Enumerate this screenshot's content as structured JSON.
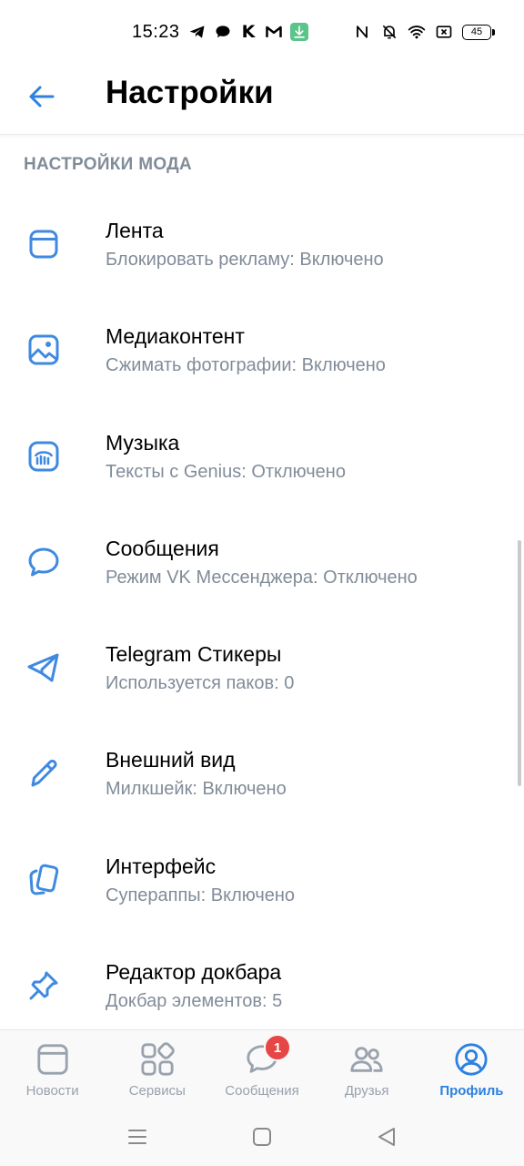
{
  "status_bar": {
    "time": "15:23",
    "battery": "45",
    "left_icons": [
      "telegram-icon",
      "chat-bubble-icon",
      "k-icon",
      "gmail-icon",
      "download-icon"
    ],
    "right_icons": [
      "nfc-icon",
      "bell-off-icon",
      "wifi-icon",
      "sim-off-icon",
      "battery-icon"
    ],
    "k_letter": "K"
  },
  "header": {
    "title": "Настройки"
  },
  "section": {
    "title": "НАСТРОЙКИ МОДА"
  },
  "items": [
    {
      "icon": "feed-icon",
      "title": "Лента",
      "subtitle": "Блокировать рекламу: Включено"
    },
    {
      "icon": "image-icon",
      "title": "Медиаконтент",
      "subtitle": "Сжимать фотографии: Включено"
    },
    {
      "icon": "music-icon",
      "title": "Музыка",
      "subtitle": "Тексты с Genius: Отключено"
    },
    {
      "icon": "message-icon",
      "title": "Сообщения",
      "subtitle": "Режим VK Мессенджера: Отключено"
    },
    {
      "icon": "telegram-icon",
      "title": "Telegram Стикеры",
      "subtitle": "Используется паков: 0"
    },
    {
      "icon": "pencil-icon",
      "title": "Внешний вид",
      "subtitle": "Милкшейк: Включено"
    },
    {
      "icon": "cards-icon",
      "title": "Интерфейс",
      "subtitle": "Супераппы: Включено"
    },
    {
      "icon": "pin-icon",
      "title": "Редактор докбара",
      "subtitle": "Докбар элементов: 5"
    }
  ],
  "bottom_nav": [
    {
      "icon": "news-icon",
      "label": "Новости",
      "active": false
    },
    {
      "icon": "services-icon",
      "label": "Сервисы",
      "active": false
    },
    {
      "icon": "messages-icon",
      "label": "Сообщения",
      "active": false,
      "badge": "1"
    },
    {
      "icon": "friends-icon",
      "label": "Друзья",
      "active": false
    },
    {
      "icon": "profile-icon",
      "label": "Профиль",
      "active": true
    }
  ],
  "colors": {
    "accent": "#2d81e0",
    "icon_blue": "#3f8ae0",
    "secondary_text": "#818c99",
    "inactive_nav": "#99a2ad",
    "badge": "#e64646"
  }
}
